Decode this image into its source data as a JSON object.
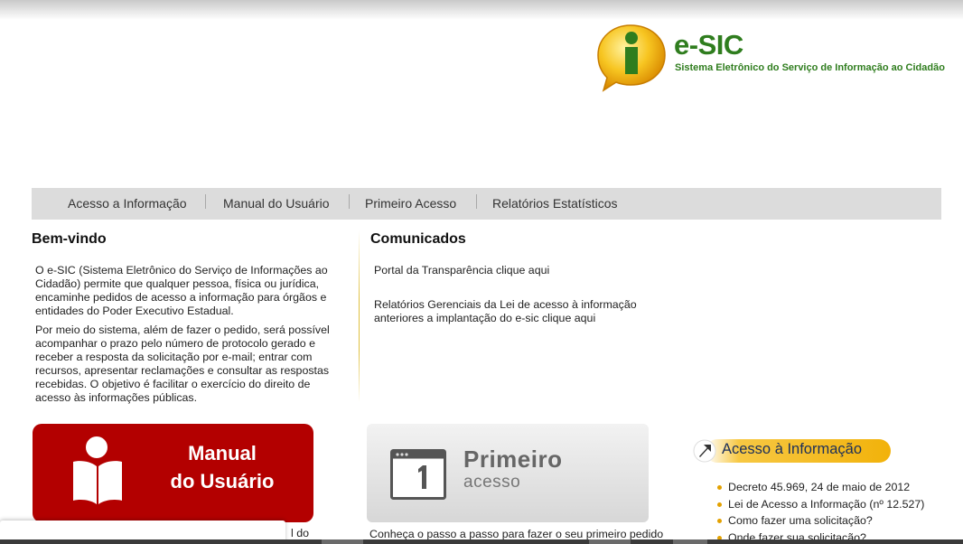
{
  "logo": {
    "title": "e-SIC",
    "subtitle": "Sistema Eletrônico do Serviço de Informação ao Cidadão",
    "icon": "info-balloon-icon"
  },
  "nav": {
    "items": [
      {
        "label": "Acesso a Informação"
      },
      {
        "label": "Manual do Usuário"
      },
      {
        "label": "Primeiro Acesso"
      },
      {
        "label": "Relatórios Estatísticos"
      }
    ]
  },
  "welcome": {
    "heading": "Bem-vindo",
    "para1": "O e-SIC (Sistema Eletrônico do Serviço de Informações ao Cidadão) permite que qualquer pessoa, física ou jurídica, encaminhe pedidos de acesso a informação para órgãos e entidades do Poder Executivo Estadual.",
    "para2": "Por meio do sistema, além de fazer o pedido, será possível acompanhar o prazo pelo número de protocolo gerado e receber a resposta da solicitação por e-mail; entrar com recursos, apresentar reclamações e consultar as respostas recebidas. O objetivo é facilitar o exercício do direito de acesso às informações públicas."
  },
  "comunicados": {
    "heading": "Comunicados",
    "items": [
      {
        "text": "Portal da Transparência clique aqui"
      },
      {
        "text": "Relatórios Gerenciais da Lei de acesso à informação anteriores a implantação do e-sic clique aqui"
      }
    ]
  },
  "manual_banner": {
    "line1": "Manual",
    "line2": "do Usuário",
    "icon": "reader-person-icon"
  },
  "primeiro_banner": {
    "line1": "Primeiro",
    "line2": "acesso",
    "icon": "calendar-day-1-icon",
    "caption": "Conheça o passo a passo para fazer o seu primeiro pedido"
  },
  "acesso_box": {
    "heading": "Acesso à Informação",
    "icon": "arrow-pointer-icon",
    "items": [
      {
        "text": "Decreto 45.969, 24 de maio de 2012"
      },
      {
        "text": "Lei de Acesso a Informação (nº 12.527)"
      },
      {
        "text": "Como fazer uma solicitação?"
      },
      {
        "text": "Onde fazer sua solicitação?"
      }
    ]
  },
  "bottom_snip": "l do",
  "colors": {
    "brand_green": "#2f7d1e",
    "banner_red": "#b30000",
    "nav_bg": "#dcdcdc",
    "accent_yellow": "#f2b20a",
    "bullet": "#e3a100"
  }
}
